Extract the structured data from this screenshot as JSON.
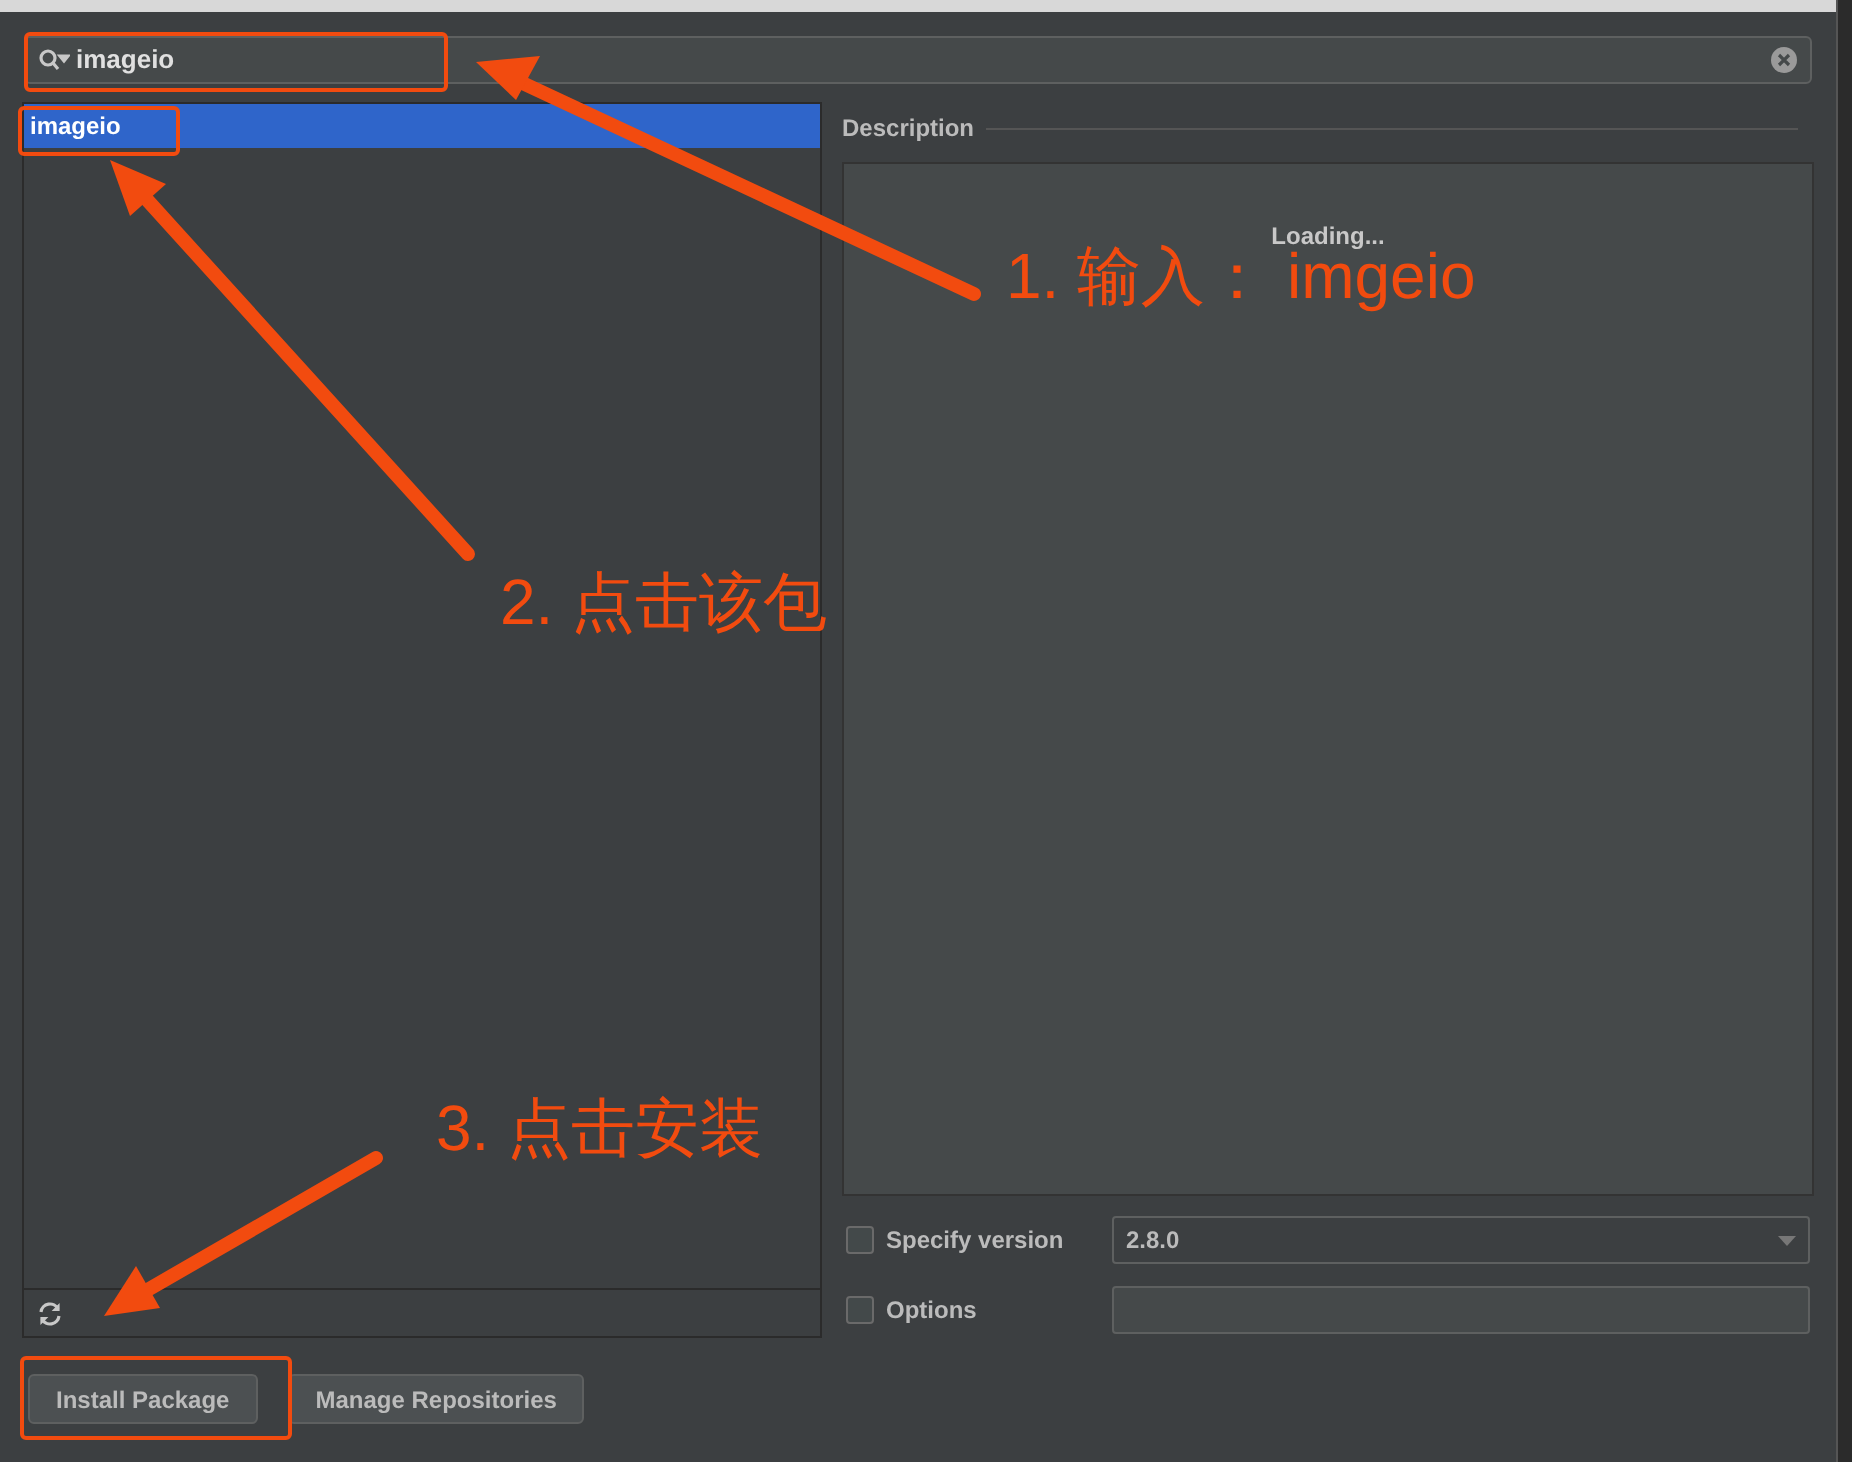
{
  "search": {
    "value": "imageio"
  },
  "packages": [
    {
      "name": "imageio",
      "selected": true
    }
  ],
  "description": {
    "label": "Description",
    "status": "Loading..."
  },
  "options": [
    {
      "kind": "dropdown",
      "label": "Specify version",
      "checked": false,
      "value": "2.8.0"
    },
    {
      "kind": "text",
      "label": "Options",
      "checked": false
    }
  ],
  "buttons": [
    "Install Package",
    "Manage Repositories"
  ],
  "annotations": [
    "1. 输入： imgeio",
    "2. 点击该包",
    "3. 点击安装"
  ]
}
